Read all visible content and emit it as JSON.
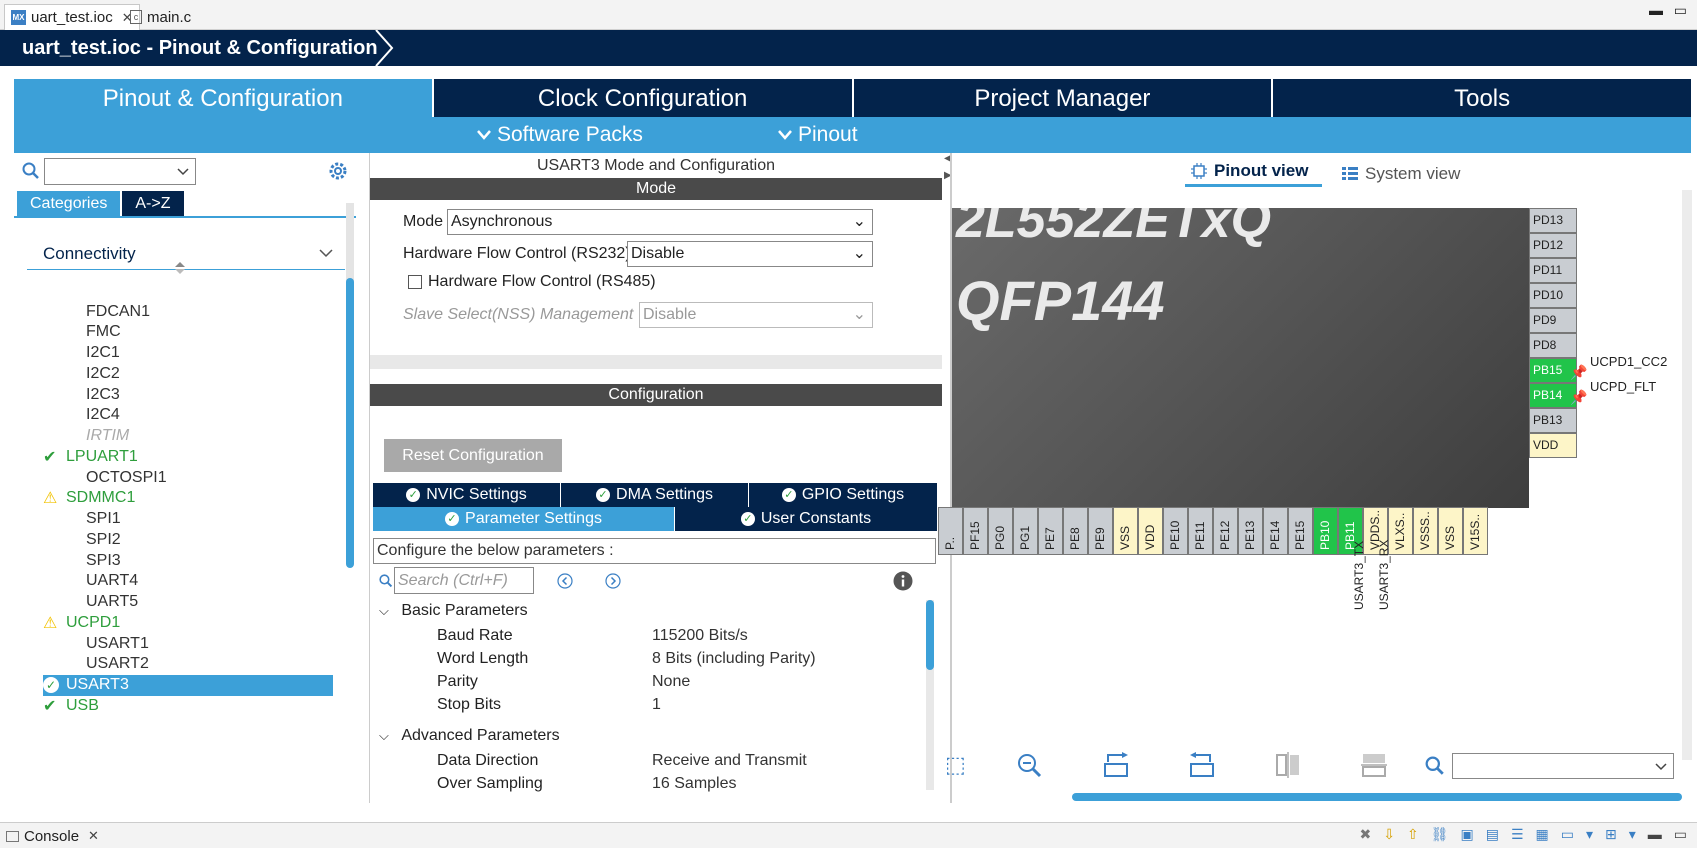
{
  "editor_tabs": [
    {
      "label": "uart_test.ioc",
      "icon": "MX"
    },
    {
      "label": "main.c",
      "icon": "c"
    }
  ],
  "title": "uart_test.ioc - Pinout & Configuration",
  "main_tabs": [
    "Pinout & Configuration",
    "Clock Configuration",
    "Project Manager",
    "Tools"
  ],
  "sub_menu": [
    "Software Packs",
    "Pinout"
  ],
  "left": {
    "category_tabs": [
      "Categories",
      "A->Z"
    ],
    "group": "Connectivity",
    "peripherals": [
      {
        "name": "FDCAN1",
        "state": "normal"
      },
      {
        "name": "FMC",
        "state": "normal"
      },
      {
        "name": "I2C1",
        "state": "normal"
      },
      {
        "name": "I2C2",
        "state": "normal"
      },
      {
        "name": "I2C3",
        "state": "normal"
      },
      {
        "name": "I2C4",
        "state": "normal"
      },
      {
        "name": "IRTIM",
        "state": "disabled"
      },
      {
        "name": "LPUART1",
        "state": "ok"
      },
      {
        "name": "OCTOSPI1",
        "state": "normal"
      },
      {
        "name": "SDMMC1",
        "state": "warn"
      },
      {
        "name": "SPI1",
        "state": "normal"
      },
      {
        "name": "SPI2",
        "state": "normal"
      },
      {
        "name": "SPI3",
        "state": "normal"
      },
      {
        "name": "UART4",
        "state": "normal"
      },
      {
        "name": "UART5",
        "state": "normal"
      },
      {
        "name": "UCPD1",
        "state": "warn"
      },
      {
        "name": "USART1",
        "state": "normal"
      },
      {
        "name": "USART2",
        "state": "normal"
      },
      {
        "name": "USART3",
        "state": "selected"
      },
      {
        "name": "USB",
        "state": "ok"
      }
    ]
  },
  "middle": {
    "header": "USART3 Mode and Configuration",
    "mode_section": "Mode",
    "mode_label": "Mode",
    "mode_value": "Asynchronous",
    "hw_flow_label": "Hardware Flow Control (RS232)",
    "hw_flow_value": "Disable",
    "rs485_label": "Hardware Flow Control (RS485)",
    "nss_label": "Slave Select(NSS) Management",
    "nss_value": "Disable",
    "config_section": "Configuration",
    "reset_button": "Reset Configuration",
    "config_tabs_row1": [
      "NVIC Settings",
      "DMA Settings",
      "GPIO Settings"
    ],
    "config_tabs_row2": [
      "Parameter Settings",
      "User Constants"
    ],
    "hint": "Configure the below parameters :",
    "search_placeholder": "Search (Ctrl+F)",
    "basic_group": "Basic Parameters",
    "basic_params": [
      {
        "name": "Baud Rate",
        "value": "115200 Bits/s"
      },
      {
        "name": "Word Length",
        "value": "8 Bits (including Parity)"
      },
      {
        "name": "Parity",
        "value": "None"
      },
      {
        "name": "Stop Bits",
        "value": "1"
      }
    ],
    "advanced_group": "Advanced Parameters",
    "advanced_params": [
      {
        "name": "Data Direction",
        "value": "Receive and Transmit"
      },
      {
        "name": "Over Sampling",
        "value": "16 Samples"
      }
    ]
  },
  "right": {
    "view_tabs": [
      "Pinout view",
      "System view"
    ],
    "chip_part": "2L552ZETxQ",
    "chip_package": "QFP144",
    "right_pins": [
      {
        "name": "PD13",
        "kind": "gray"
      },
      {
        "name": "PD12",
        "kind": "gray"
      },
      {
        "name": "PD11",
        "kind": "gray"
      },
      {
        "name": "PD10",
        "kind": "gray"
      },
      {
        "name": "PD9",
        "kind": "gray"
      },
      {
        "name": "PD8",
        "kind": "gray"
      },
      {
        "name": "PB15",
        "kind": "green"
      },
      {
        "name": "PB14",
        "kind": "green"
      },
      {
        "name": "PB13",
        "kind": "gray"
      },
      {
        "name": "VDD",
        "kind": "yellow"
      }
    ],
    "right_signals": [
      "UCPD1_CC2",
      "UCPD_FLT"
    ],
    "bottom_pins": [
      {
        "name": "P..",
        "kind": "gray"
      },
      {
        "name": "PF15",
        "kind": "gray"
      },
      {
        "name": "PG0",
        "kind": "gray"
      },
      {
        "name": "PG1",
        "kind": "gray"
      },
      {
        "name": "PE7",
        "kind": "gray"
      },
      {
        "name": "PE8",
        "kind": "gray"
      },
      {
        "name": "PE9",
        "kind": "gray"
      },
      {
        "name": "VSS",
        "kind": "yellow"
      },
      {
        "name": "VDD",
        "kind": "yellow"
      },
      {
        "name": "PE10",
        "kind": "gray"
      },
      {
        "name": "PE11",
        "kind": "gray"
      },
      {
        "name": "PE12",
        "kind": "gray"
      },
      {
        "name": "PE13",
        "kind": "gray"
      },
      {
        "name": "PE14",
        "kind": "gray"
      },
      {
        "name": "PE15",
        "kind": "gray"
      },
      {
        "name": "PB10",
        "kind": "green"
      },
      {
        "name": "PB11",
        "kind": "green"
      },
      {
        "name": "VDDS..",
        "kind": "yellow"
      },
      {
        "name": "VLXS..",
        "kind": "yellow"
      },
      {
        "name": "VSSS..",
        "kind": "yellow"
      },
      {
        "name": "VSS",
        "kind": "yellow"
      },
      {
        "name": "V15S..",
        "kind": "yellow"
      }
    ],
    "bottom_signals": [
      "USART3_TX",
      "USART3_RX"
    ]
  },
  "console": {
    "label": "Console"
  },
  "colors": {
    "navy": "#03234b",
    "accent": "#3ca0d8",
    "ok": "#2e9e3c",
    "warn": "#f2c200",
    "pin_green": "#21c44a"
  }
}
